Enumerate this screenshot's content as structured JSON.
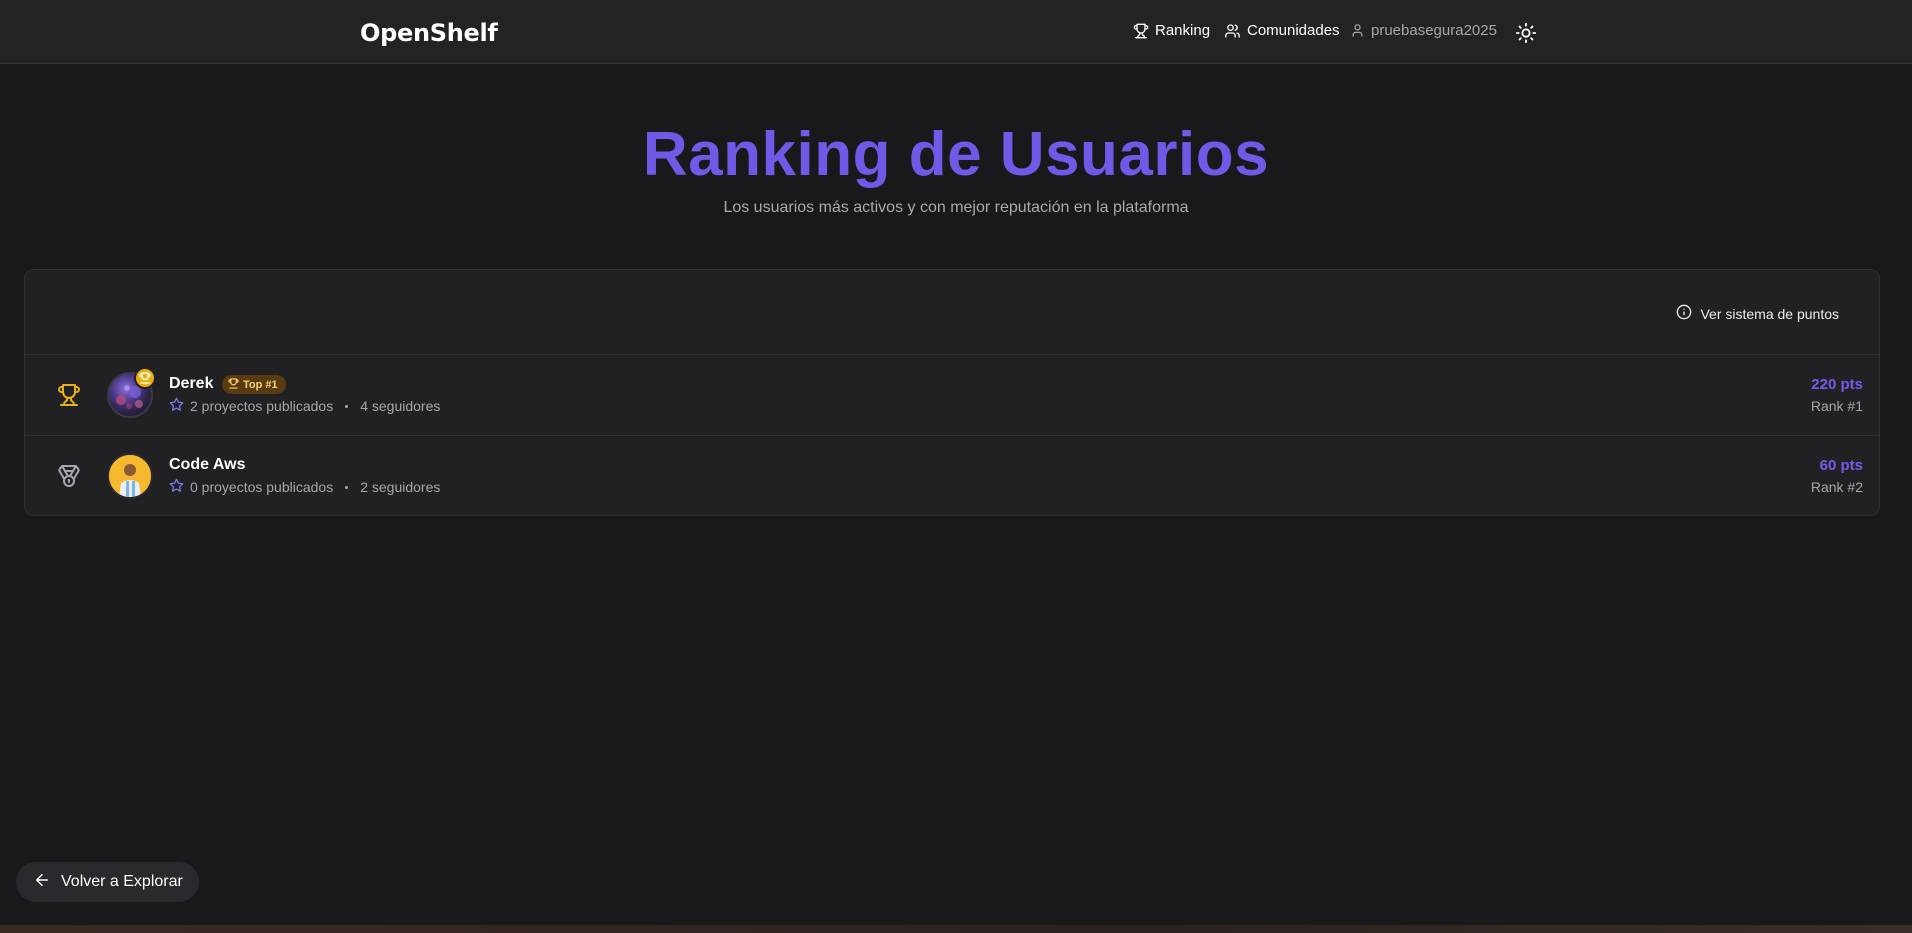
{
  "header": {
    "logo": "OpenShelf",
    "nav": {
      "ranking": "Ranking",
      "comunidades": "Comunidades",
      "user": "pruebasegura2025"
    }
  },
  "hero": {
    "title": "Ranking de Usuarios",
    "subtitle": "Los usuarios más activos y con mejor reputación en la plataforma"
  },
  "panel": {
    "points_link": "Ver sistema de puntos"
  },
  "users": [
    {
      "name": "Derek",
      "badge": "Top #1",
      "projects": "2 proyectos publicados",
      "followers": "4 seguidores",
      "points": "220 pts",
      "rank": "Rank #1",
      "rank_icon": "trophy-icon"
    },
    {
      "name": "Code Aws",
      "projects": "0 proyectos publicados",
      "followers": "2 seguidores",
      "points": "60 pts",
      "rank": "Rank #2",
      "rank_icon": "medal-icon"
    }
  ],
  "footer": {
    "back_label": "Volver a Explorar"
  },
  "colors": {
    "accent": "#6f5ae8",
    "points": "#7a58ec",
    "gold": "#e9b012",
    "background": "#19191c"
  }
}
